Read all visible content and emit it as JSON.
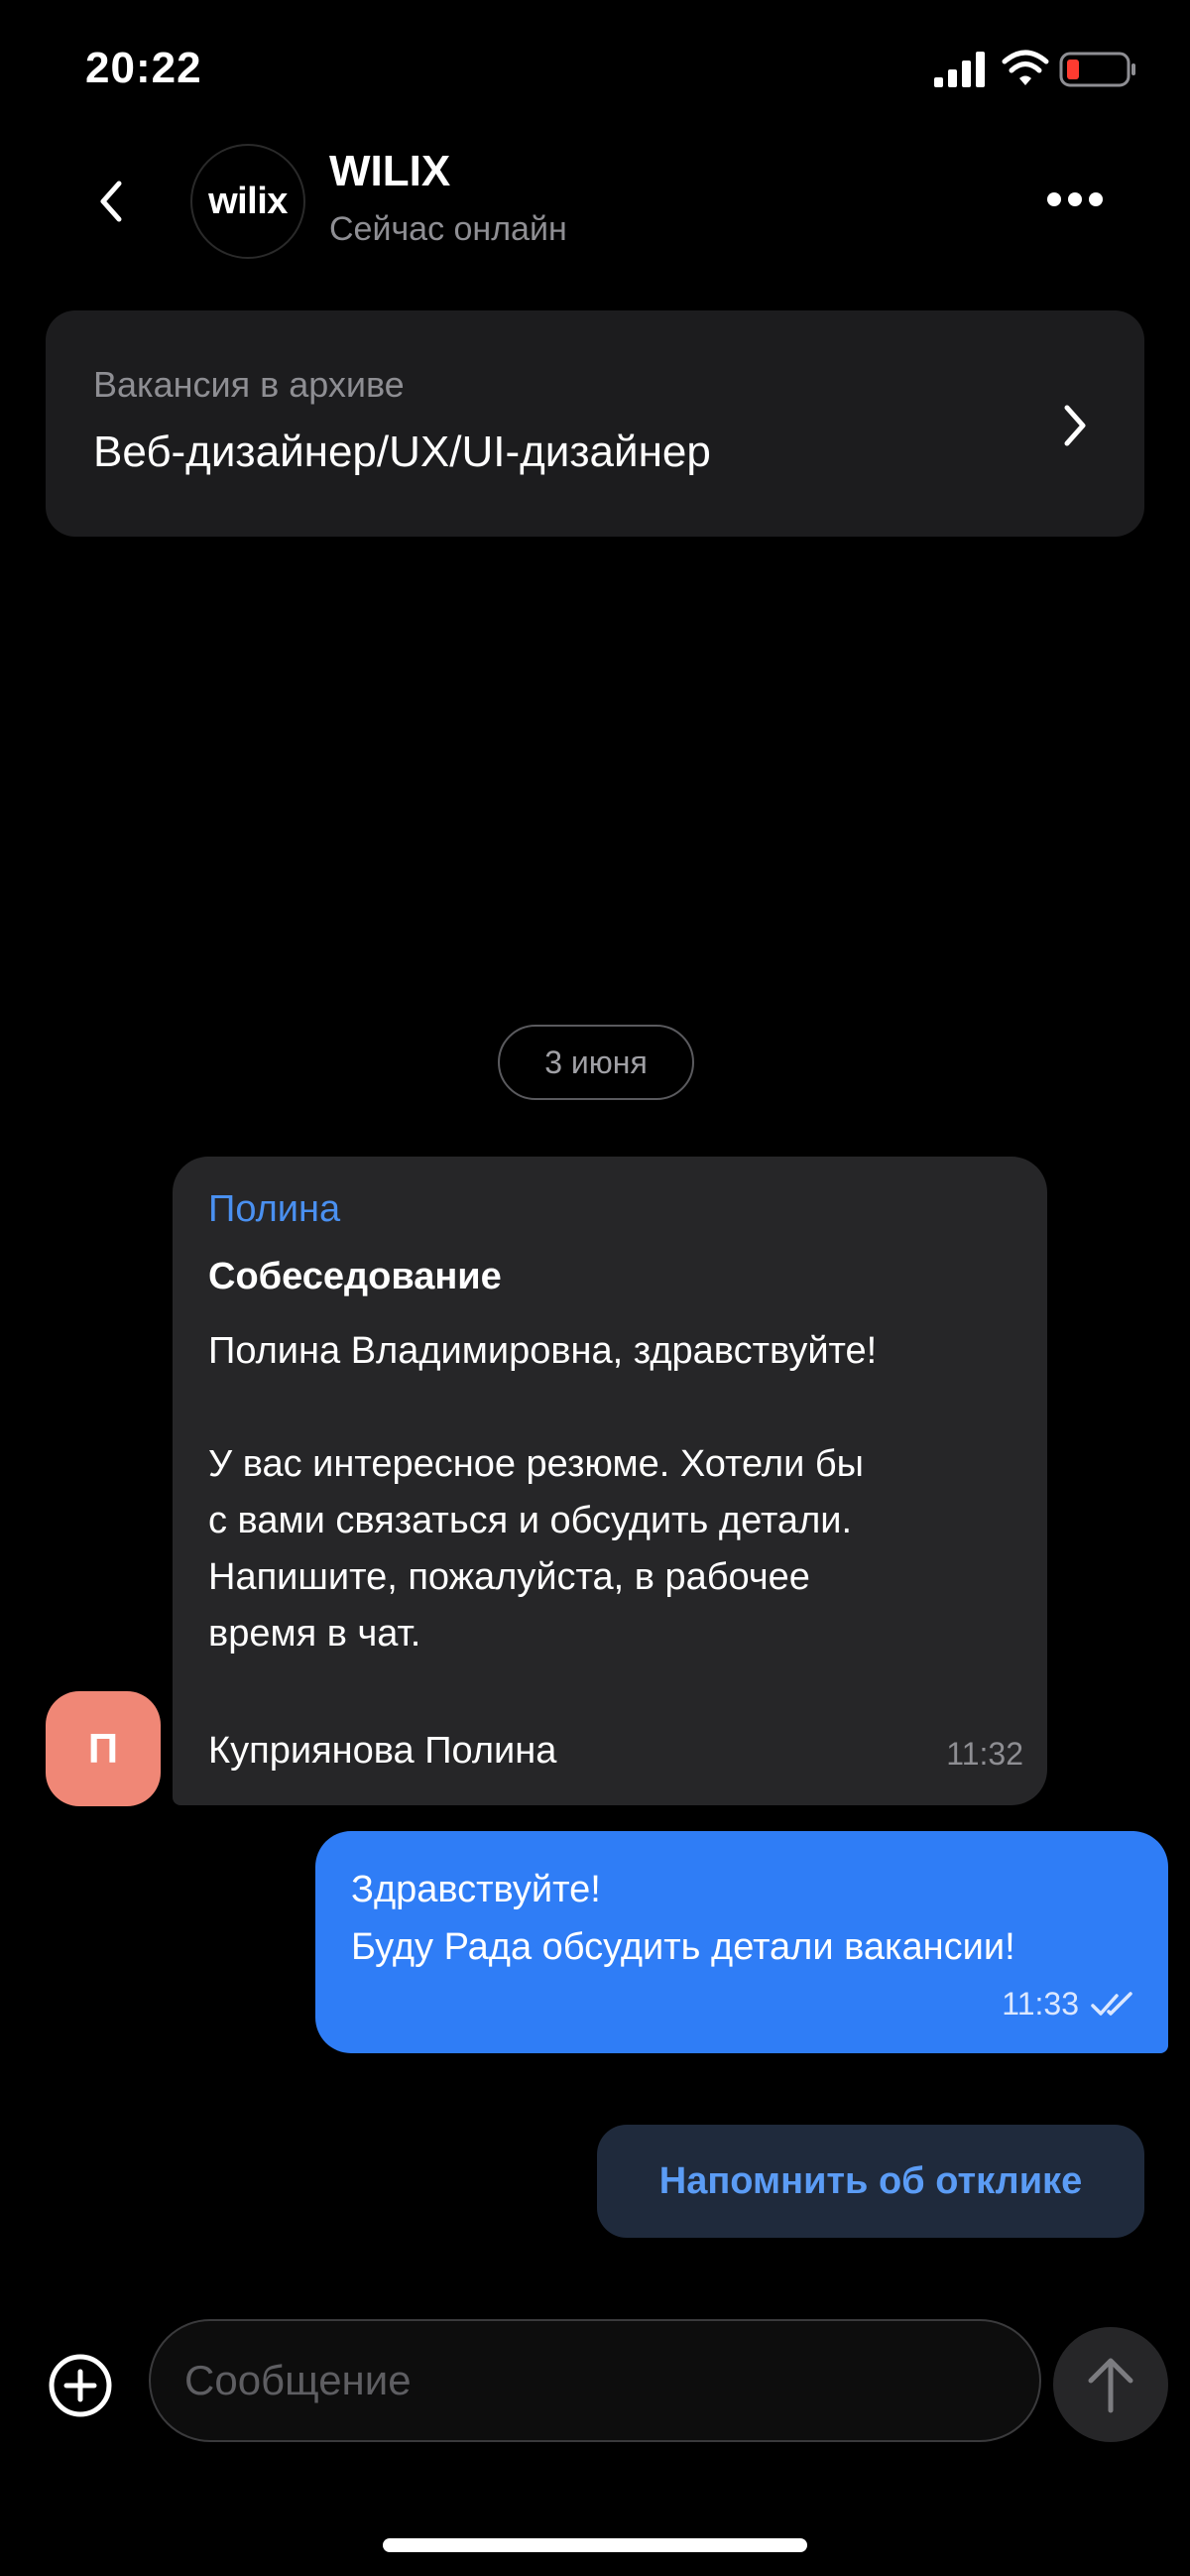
{
  "status_bar": {
    "time": "20:22",
    "icons": [
      "signal-icon",
      "wifi-icon",
      "battery-low-icon"
    ],
    "battery_color": "#ff3b30"
  },
  "header": {
    "back_icon": "chevron-left-icon",
    "logo_text": "wilix",
    "title": "WILIX",
    "subtitle": "Сейчас онлайн",
    "more_icon": "more-horizontal-icon"
  },
  "vacancy": {
    "status": "Вакансия в архиве",
    "title": "Веб-дизайнер/UX/UI-дизайнер",
    "arrow_icon": "chevron-right-icon"
  },
  "date_chip": "3 июня",
  "messages": [
    {
      "direction": "incoming",
      "sender": "Полина",
      "subject": "Собеседование",
      "body": "Полина Владимировна, здравствуйте!\n\nУ вас интересное резюме. Хотели бы\nс вами связаться и обсудить детали.\nНапишите, пожалуйста, в рабочее\nвремя в чат.",
      "signature": "Куприянова Полина",
      "time": "11:32",
      "avatar_letter": "П",
      "avatar_color": "#f08776"
    },
    {
      "direction": "outgoing",
      "text": "Здравствуйте!\nБуду Рада обсудить детали вакансии!",
      "time": "11:33",
      "status_icon": "double-check-icon",
      "bubble_color": "#2f7df6"
    }
  ],
  "remind_button": "Напомнить об отклике",
  "composer": {
    "add_icon": "plus-circle-icon",
    "placeholder": "Сообщение",
    "value": "",
    "send_icon": "arrow-up-icon"
  },
  "colors": {
    "background": "#000000",
    "surface": "#1c1c1e",
    "accent": "#4a90f0"
  }
}
